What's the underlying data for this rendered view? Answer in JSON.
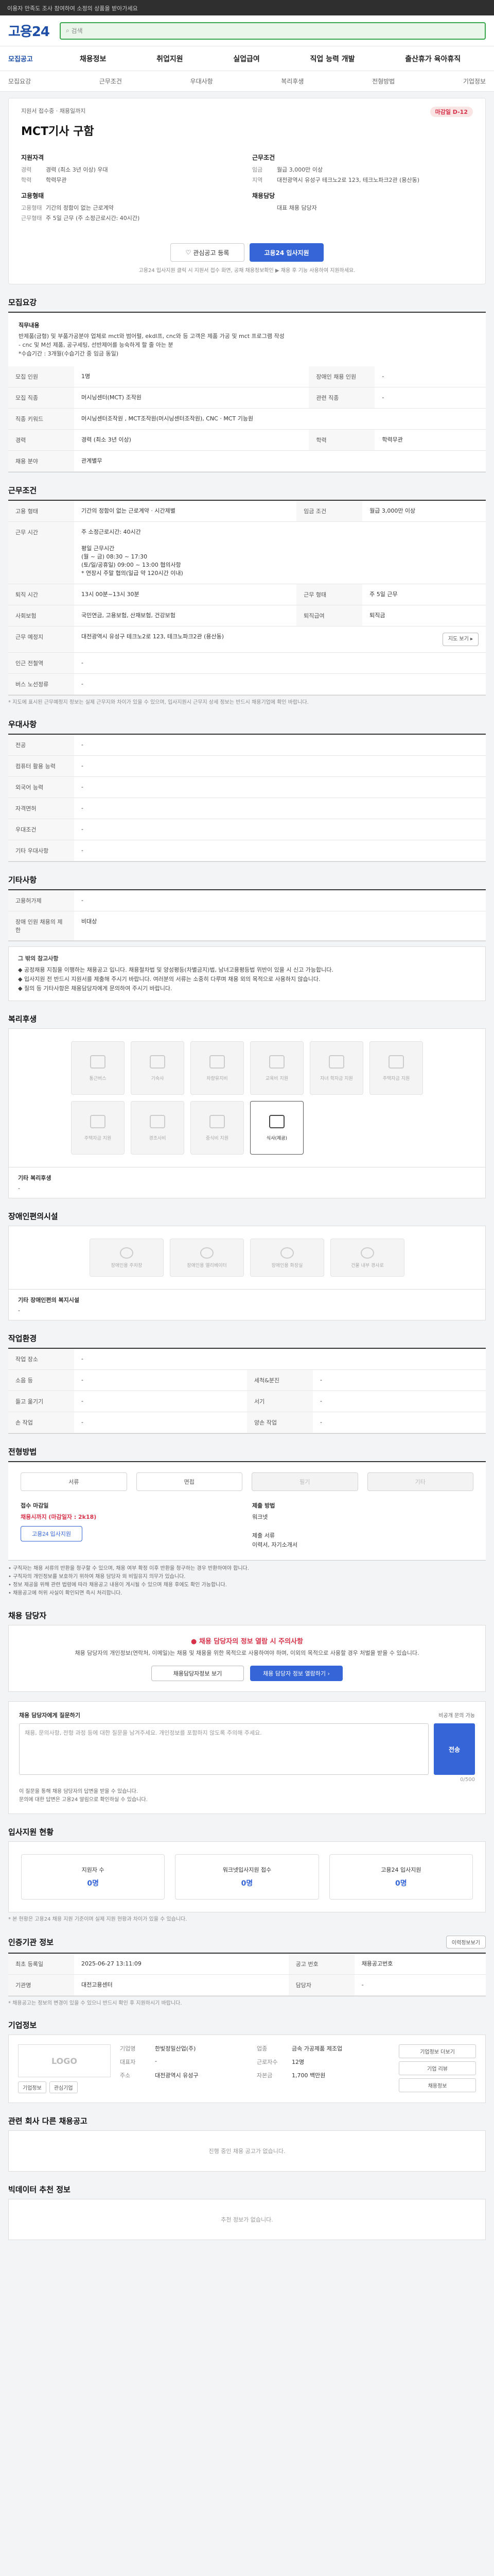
{
  "topbar": {
    "text": "이용자 만족도 조사 참여하여 소정의 상품을 받아가세요"
  },
  "header": {
    "logo": "고용24",
    "search_placeholder": "검색"
  },
  "gnb": {
    "home": "모집공고",
    "items": [
      "채용정보",
      "취업지원",
      "실업급여",
      "직업 능력 개발",
      "출산휴가 육아휴직"
    ]
  },
  "subnav": {
    "items": [
      "모집요강",
      "근무조건",
      "우대사항",
      "복리후생",
      "전형방법",
      "기업정보"
    ]
  },
  "job": {
    "company_line": "지원서 접수중 · 채용일까지",
    "status_badge": "마감일 D-12",
    "title": "MCT기사 구함",
    "col1_h": "지원자격",
    "rows1": [
      {
        "k": "경력",
        "v": "경력 (최소 3년 이상) 우대"
      },
      {
        "k": "학력",
        "v": "학력무관"
      }
    ],
    "col2_h": "근무조건",
    "rows2": [
      {
        "k": "임금",
        "v": "월급 3,000만 이상"
      },
      {
        "k": "지역",
        "v": "대전광역시 유성구 테크노2로 123, 테크노파크2관 (용산동)"
      }
    ],
    "col3_h": "고용형태",
    "rows3": [
      {
        "k": "고용형태",
        "v": "기간의 정함이 없는 근로계약"
      },
      {
        "k": "근무형태",
        "v": "주 5일 근무 (주 소정근로시간: 40시간)"
      }
    ],
    "col4_h": "채용담당",
    "rows4": [
      {
        "k": "",
        "v": "대표 채용 담당자"
      }
    ],
    "btn_save": "관심공고 등록",
    "btn_apply": "고용24 입사지원",
    "notice": "고용24 입사지원 클릭 시 지원서 접수 화면, 공채 채용정보확인 ▶ 채용 후 기능 사용하여 지원하세요."
  },
  "sections": {
    "recruit": "모집요강",
    "work": "근무조건",
    "pref": "우대사항",
    "other": "기타사항",
    "welfare": "복리후생",
    "disability": "장애인편의시설",
    "worksite": "작업환경",
    "method": "전형방법",
    "hr": "채용 담당자",
    "stats": "입사지원 현황",
    "history": "인증기관 정보",
    "company": "기업정보",
    "related": "관련 회사 다른 채용공고",
    "recommend": "빅데이터 추천 정보"
  },
  "recruit": {
    "duty_h": "직무내용",
    "duty_lines": [
      "반제품(금형) 및 부품가공분야 업체로 mct와 범어펄, ekdl프, cnc와 등 고객은 제품 가공 및 mct 프로그램 작성",
      "- cnc 및 M선 제품, 공구세팅, 선반제어를 능숙하게 할 줄 아는 분",
      "*수습기간 : 3개월(수습기간 중 임금 동일)"
    ],
    "rows": [
      {
        "k": "모집 인원",
        "v": "1명",
        "k2": "장애인 채용 인원",
        "v2": "-"
      },
      {
        "k": "모집 직종",
        "v": "머시닝센터(MCT) 조작원",
        "k2": "관련 직종",
        "v2": "-"
      },
      {
        "k": "직종 키워드",
        "v": "머시닝센터조작원 , MCT조작원(머시닝센터조작원), CNC · MCT 기능원",
        "k2": "",
        "v2": ""
      },
      {
        "k": "경력",
        "v": "경력 (최소 3년 이상)",
        "k2": "학력",
        "v2": "학력무관"
      },
      {
        "k": "채용 분야",
        "v": "관계별무",
        "k2": "",
        "v2": ""
      }
    ]
  },
  "work": {
    "rows": [
      {
        "k": "고용 형태",
        "v": "기간의 정함이 없는 근로계약 · 시간제별",
        "k2": "임금 조건",
        "v2": "월급 3,000만 이상"
      },
      {
        "k": "근무 시간",
        "v": "주 소정근로시간: 40시간\n\n평일 근무시간\n(월 ~ 금) 08:30 ~ 17:30\n(토/일/공휴일) 09:00 ~ 13:00 협의사항\n* 연장시 주말 협의(일급 약 120시간 이내)",
        "k2": "",
        "v2": ""
      },
      {
        "k": "퇴직 시간",
        "v": "13시 00분~13시 30분",
        "k2": "근무 형태",
        "v2": "주 5일 근무"
      },
      {
        "k": "사회보험",
        "v": "국민연금, 고용보험, 산재보험, 건강보험",
        "k2": "퇴직급여",
        "v2": "퇴직금"
      },
      {
        "k": "근무 예정지",
        "v": "대전광역시 유성구 테크노2로 123, 테크노파크2관 (용산동)",
        "k2": "",
        "v2": ""
      },
      {
        "k": "인근 전철역",
        "v": "-",
        "k2": "",
        "v2": ""
      },
      {
        "k": "버스 노선정류",
        "v": "-",
        "k2": "",
        "v2": ""
      }
    ],
    "map_btn": "지도 보기 ▸",
    "note": "* 지도에 표시된 근무예정지 정보는 실제 근무지와 차이가 있을 수 있으며, 입사지원시 근무지 상세 정보는 반드시 채용기업에 확인 바랍니다."
  },
  "pref": {
    "rows": [
      {
        "k": "전공",
        "v": "-"
      },
      {
        "k": "컴퓨터 활용 능력",
        "v": "-"
      },
      {
        "k": "외국어 능력",
        "v": "-"
      },
      {
        "k": "자격면허",
        "v": "-"
      },
      {
        "k": "우대조건",
        "v": "-"
      },
      {
        "k": "기타 우대사항",
        "v": "-"
      }
    ]
  },
  "other": {
    "rows": [
      {
        "k": "고용허가제",
        "v": "-"
      },
      {
        "k": "장애 인원 채용의 제한",
        "v": "비대상"
      }
    ],
    "box_h": "그 밖의 참고사항",
    "box_lines": [
      "◆ 공정채용 지침을 이행하는 채용공고 입니다. 채용절차법 및 양성평등(차별금지)법, 남녀고용평등법 위반이 있을 시 신고 가능합니다.",
      "◆ 입사지원 전 반드시 지원서를 제출해 주시기 바랍니다. 여러분의 서류는 소중히 다루며 채용 외의 목적으로 사용하지 않습니다.",
      "◆ 질의 등 기타사항은 채용담당자에게 문의하여 주시기 바랍니다."
    ]
  },
  "welfare": {
    "tiles": [
      {
        "label": "통근버스",
        "on": false
      },
      {
        "label": "기숙사",
        "on": false
      },
      {
        "label": "차량유지비",
        "on": false
      },
      {
        "label": "교육비 지원",
        "on": false
      },
      {
        "label": "자녀 학자금 지원",
        "on": false
      },
      {
        "label": "주택자금 지원",
        "on": false
      },
      {
        "label": "주택자금 지원",
        "on": false
      },
      {
        "label": "경조사비",
        "on": false
      },
      {
        "label": "중식비 지원",
        "on": false
      },
      {
        "label": "식사(제공)",
        "on": true
      }
    ],
    "other_k": "기타 복리후생",
    "other_v": "-"
  },
  "disability": {
    "tiles": [
      "장애인용 주차장",
      "장애인용 엘리베이터",
      "장애인용 화장실",
      "건물 내부 경사로"
    ],
    "other_k": "기타 장애인편의 복지시설",
    "other_v": "-"
  },
  "worksite": {
    "rows": [
      {
        "k": "작업 장소",
        "v": "-",
        "k2": "",
        "v2": ""
      },
      {
        "k": "소음 등",
        "v": "-",
        "k2": "세척&분진",
        "v2": "-"
      },
      {
        "k": "들고 옮기기",
        "v": "-",
        "k2": "서기",
        "v2": "-"
      },
      {
        "k": "손 작업",
        "v": "-",
        "k2": "양손 작업",
        "v2": "-"
      }
    ]
  },
  "method": {
    "items": [
      {
        "label": "서류",
        "dis": false
      },
      {
        "label": "면접",
        "dis": false
      },
      {
        "label": "필기",
        "dis": true
      },
      {
        "label": "기타",
        "dis": true
      }
    ],
    "deadline_k": "접수 마감일",
    "deadline_v": "채용시까지 (마감일자 : 2k18)",
    "apply": "고용24 입사지원",
    "submit_k": "제출 방법",
    "submit_v": "워크넷\n\n제출 서류\n이력서, 자기소개서",
    "warn": [
      "구직자는 채용 서류의 반환을 청구할 수 있으며, 채용 여부 확정 이후 반환을 청구하는 경우 반환하여야 합니다.",
      "구직자의 개인정보를 보호하기 위하여 채용 담당자 외 비밀유지 의무가 있습니다.",
      "정보 제공을 위해 관련 법령에 따라 채용공고 내용이 게시될 수 있으며 채용 후에도 확인 가능합니다.",
      "채용공고에 허위 사실이 확인되면 즉시 처리합니다."
    ]
  },
  "hr": {
    "alert_h": "채용 담당자의 정보 열람 시 주의사항",
    "alert_t": "채용 담당자의 개인정보(연락처, 이메일)는 채용 및 채용을 위한 목적으로 사용하여야 하며, 이외의 목적으로 사용할 경우 처벌을 받을 수 있습니다.",
    "btn1": "채용담당자정보 보기",
    "btn2": "채용 담당자 정보 열람하기 ›"
  },
  "inquiry": {
    "h": "채용 담당자에게 질문하기",
    "note": "비공개 문의 가능",
    "placeholder": "채용, 문의사항, 전형 과정 등에 대한 질문을 남겨주세요. 개인정보를 포함하지 않도록 주의해 주세요.",
    "btn": "전송",
    "count": "0/500",
    "notes": [
      "이 질문을 통해 채용 담당자의 답변을 받을 수 있습니다.",
      "문의에 대한 답변은 고용24 알림으로 확인하실 수 있습니다."
    ]
  },
  "stats": {
    "items": [
      {
        "label": "지원자 수",
        "value": "0명"
      },
      {
        "label": "워크넷입사지원 접수",
        "value": "0명"
      },
      {
        "label": "고용24 입사지원",
        "value": "0명"
      }
    ],
    "note": "* 본 현황은 고용24 채용 지원 기준이며 실제 지원 현황과 차이가 있을 수 있습니다."
  },
  "history": {
    "btn": "이력정보보기",
    "rows": [
      {
        "k": "최초 등록일",
        "v": "2025-06-27 13:11:09",
        "k2": "공고 번호",
        "v2": "채용공고번호"
      },
      {
        "k": "기관명",
        "v": "대전고용센터",
        "k2": "담당자",
        "v2": "-"
      }
    ],
    "note": "* 채용공고는 정보의 변경이 있을 수 있으니 반드시 확인 후 지원하시기 바랍니다."
  },
  "company": {
    "logo": "LOGO",
    "btn1": "기업정보",
    "btn2": "관심기업",
    "info": [
      {
        "k": "기업명",
        "v": "한빛정밀산업(주)"
      },
      {
        "k": "업종",
        "v": "금속 가공제품 제조업"
      },
      {
        "k": "대표자",
        "v": "-"
      },
      {
        "k": "근로자수",
        "v": "12명"
      },
      {
        "k": "주소",
        "v": "대전광역시 유성구"
      },
      {
        "k": "자본금",
        "v": "1,700 백만원"
      }
    ],
    "side1": "기업정보 더보기",
    "side2": "기업 리뷰",
    "side3": "채용정보"
  },
  "related": {
    "empty": "진행 중인 채용 공고가 없습니다."
  },
  "recommend": {
    "empty": "추천 정보가 없습니다."
  }
}
